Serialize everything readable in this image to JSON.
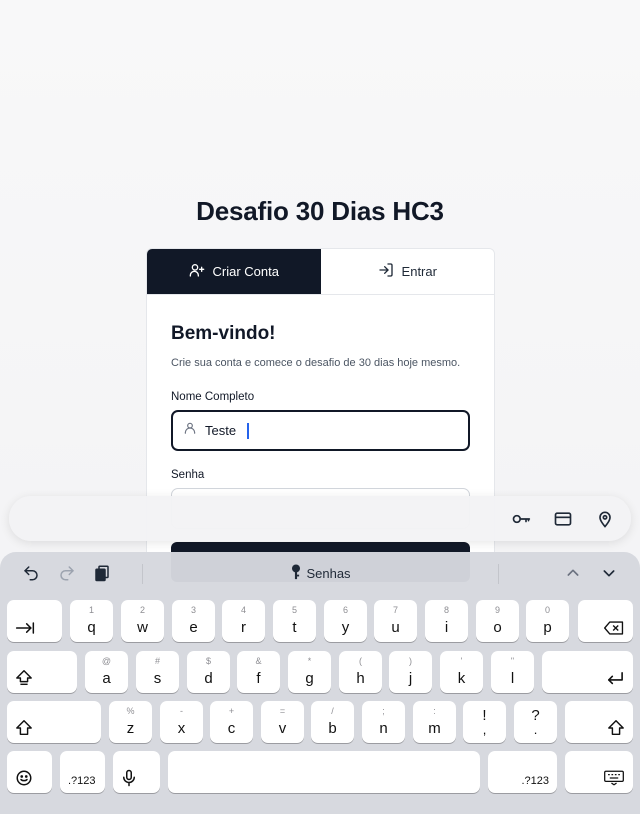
{
  "app_title": "Desafio 30 Dias HC3",
  "tabs": [
    {
      "label": "Criar Conta",
      "icon": "user-plus-icon",
      "active": true
    },
    {
      "label": "Entrar",
      "icon": "log-in-icon",
      "active": false
    }
  ],
  "form": {
    "heading": "Bem-vindo!",
    "subtitle": "Crie sua conta e comece o desafio de 30 dias hoje mesmo.",
    "name_label": "Nome Completo",
    "name_value": "Teste",
    "password_label": "Senha"
  },
  "autofill_bar": {
    "icons": [
      "key-icon",
      "credit-card-icon",
      "location-pin-icon"
    ]
  },
  "keyboard_toolbar": {
    "passwords_label": "Senhas",
    "icons": [
      "undo-icon",
      "redo-icon",
      "clipboard-icon",
      "key-icon",
      "chevron-up-icon",
      "chevron-down-icon"
    ]
  },
  "keyboard": {
    "row1": [
      {
        "hint": "1",
        "label": "q"
      },
      {
        "hint": "2",
        "label": "w"
      },
      {
        "hint": "3",
        "label": "e"
      },
      {
        "hint": "4",
        "label": "r"
      },
      {
        "hint": "5",
        "label": "t"
      },
      {
        "hint": "6",
        "label": "y"
      },
      {
        "hint": "7",
        "label": "u"
      },
      {
        "hint": "8",
        "label": "i"
      },
      {
        "hint": "9",
        "label": "o"
      },
      {
        "hint": "0",
        "label": "p"
      }
    ],
    "row2": [
      {
        "hint": "@",
        "label": "a"
      },
      {
        "hint": "#",
        "label": "s"
      },
      {
        "hint": "$",
        "label": "d"
      },
      {
        "hint": "&",
        "label": "f"
      },
      {
        "hint": "*",
        "label": "g"
      },
      {
        "hint": "(",
        "label": "h"
      },
      {
        "hint": ")",
        "label": "j"
      },
      {
        "hint": "'",
        "label": "k"
      },
      {
        "hint": "\"",
        "label": "l"
      }
    ],
    "row3": [
      {
        "hint": "%",
        "label": "z"
      },
      {
        "hint": "-",
        "label": "x"
      },
      {
        "hint": "+",
        "label": "c"
      },
      {
        "hint": "=",
        "label": "v"
      },
      {
        "hint": "/",
        "label": "b"
      },
      {
        "hint": ";",
        "label": "n"
      },
      {
        "hint": ":",
        "label": "m"
      },
      {
        "hint": "",
        "label": "!",
        "sub": ","
      },
      {
        "hint": "",
        "label": "?",
        "sub": "."
      }
    ],
    "numbers_label": ".?123",
    "numbers_label_right": ".?123"
  }
}
